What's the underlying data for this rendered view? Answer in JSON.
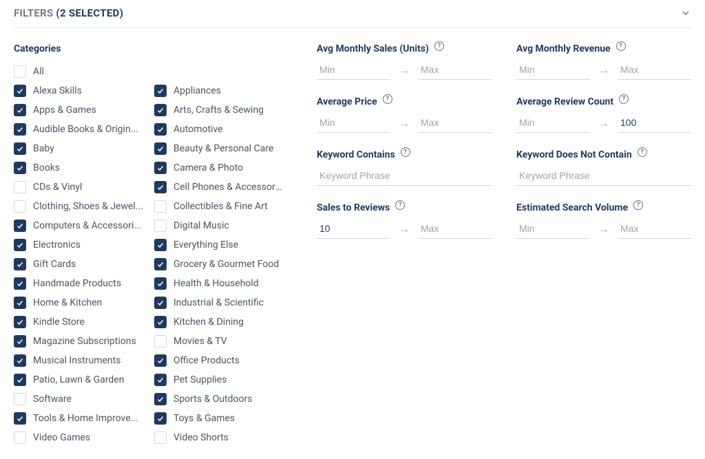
{
  "header": {
    "label": "FILTERS",
    "selected": "(2 SELECTED)"
  },
  "categories": {
    "title": "Categories",
    "all_label": "All",
    "items": [
      {
        "label": "Alexa Skills",
        "checked": true
      },
      {
        "label": "Appliances",
        "checked": true
      },
      {
        "label": "Apps & Games",
        "checked": true
      },
      {
        "label": "Arts, Crafts & Sewing",
        "checked": true
      },
      {
        "label": "Audible Books & Origin...",
        "checked": true
      },
      {
        "label": "Automotive",
        "checked": true
      },
      {
        "label": "Baby",
        "checked": true
      },
      {
        "label": "Beauty & Personal Care",
        "checked": true
      },
      {
        "label": "Books",
        "checked": true
      },
      {
        "label": "Camera & Photo",
        "checked": true
      },
      {
        "label": "CDs & Vinyl",
        "checked": false
      },
      {
        "label": "Cell Phones & Accessori...",
        "checked": true
      },
      {
        "label": "Clothing, Shoes & Jewel...",
        "checked": false
      },
      {
        "label": "Collectibles & Fine Art",
        "checked": false
      },
      {
        "label": "Computers & Accessori...",
        "checked": true
      },
      {
        "label": "Digital Music",
        "checked": false
      },
      {
        "label": "Electronics",
        "checked": true
      },
      {
        "label": "Everything Else",
        "checked": true
      },
      {
        "label": "Gift Cards",
        "checked": true
      },
      {
        "label": "Grocery & Gourmet Food",
        "checked": true
      },
      {
        "label": "Handmade Products",
        "checked": true
      },
      {
        "label": "Health & Household",
        "checked": true
      },
      {
        "label": "Home & Kitchen",
        "checked": true
      },
      {
        "label": "Industrial & Scientific",
        "checked": true
      },
      {
        "label": "Kindle Store",
        "checked": true
      },
      {
        "label": "Kitchen & Dining",
        "checked": true
      },
      {
        "label": "Magazine Subscriptions",
        "checked": true
      },
      {
        "label": "Movies & TV",
        "checked": false
      },
      {
        "label": "Musical Instruments",
        "checked": true
      },
      {
        "label": "Office Products",
        "checked": true
      },
      {
        "label": "Patio, Lawn & Garden",
        "checked": true
      },
      {
        "label": "Pet Supplies",
        "checked": true
      },
      {
        "label": "Software",
        "checked": false
      },
      {
        "label": "Sports & Outdoors",
        "checked": true
      },
      {
        "label": "Tools & Home Improve...",
        "checked": true
      },
      {
        "label": "Toys & Games",
        "checked": true
      },
      {
        "label": "Video Games",
        "checked": false
      },
      {
        "label": "Video Shorts",
        "checked": false
      }
    ]
  },
  "ranges": [
    {
      "label": "Avg Monthly Sales (Units)",
      "type": "range",
      "min_placeholder": "Min",
      "max_placeholder": "Max",
      "min_value": "",
      "max_value": ""
    },
    {
      "label": "Avg Monthly Revenue",
      "type": "range",
      "min_placeholder": "Min",
      "max_placeholder": "Max",
      "min_value": "",
      "max_value": ""
    },
    {
      "label": "Average Price",
      "type": "range",
      "min_placeholder": "Min",
      "max_placeholder": "Max",
      "min_value": "",
      "max_value": ""
    },
    {
      "label": "Average Review Count",
      "type": "range",
      "min_placeholder": "Min",
      "max_placeholder": "Max",
      "min_value": "",
      "max_value": "100"
    },
    {
      "label": "Keyword Contains",
      "type": "text",
      "placeholder": "Keyword Phrase",
      "value": ""
    },
    {
      "label": "Keyword Does Not Contain",
      "type": "text",
      "placeholder": "Keyword Phrase",
      "value": ""
    },
    {
      "label": "Sales to Reviews",
      "type": "range",
      "min_placeholder": "Min",
      "max_placeholder": "Max",
      "min_value": "10",
      "max_value": ""
    },
    {
      "label": "Estimated Search Volume",
      "type": "range",
      "min_placeholder": "Min",
      "max_placeholder": "Max",
      "min_value": "",
      "max_value": ""
    }
  ]
}
